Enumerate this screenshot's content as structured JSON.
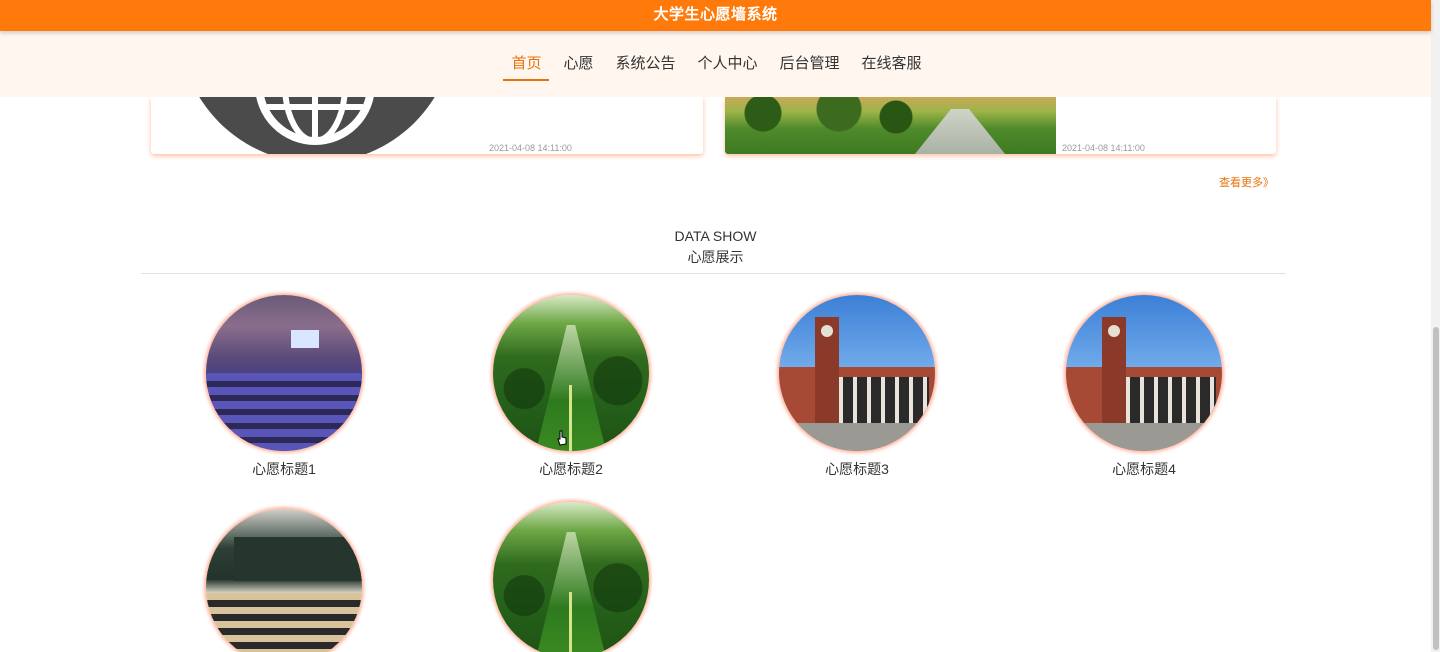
{
  "header": {
    "site_title": "大学生心愿墙系统",
    "brand_color": "#ff7a0a"
  },
  "nav": {
    "items": [
      {
        "label": "首页",
        "active": true
      },
      {
        "label": "心愿",
        "active": false
      },
      {
        "label": "系统公告",
        "active": false
      },
      {
        "label": "个人中心",
        "active": false
      },
      {
        "label": "后台管理",
        "active": false
      },
      {
        "label": "在线客服",
        "active": false
      }
    ],
    "active_color": "#e8730b"
  },
  "news": {
    "cards": [
      {
        "date": "2021-04-08 14:11:00",
        "image": "globe-icon"
      },
      {
        "date": "2021-04-08 14:11:00",
        "image": "park-path-photo"
      }
    ],
    "more_label": "查看更多》"
  },
  "section": {
    "title_en": "DATA SHOW",
    "title_cn": "心愿展示"
  },
  "wishes": [
    {
      "title": "心愿标题1",
      "image": "auditorium-photo"
    },
    {
      "title": "心愿标题2",
      "image": "tree-lined-path-photo"
    },
    {
      "title": "心愿标题3",
      "image": "campus-building-photo"
    },
    {
      "title": "心愿标题4",
      "image": "campus-building-photo"
    },
    {
      "title": "",
      "image": "classroom-photo"
    },
    {
      "title": "",
      "image": "tree-lined-path-photo"
    }
  ]
}
